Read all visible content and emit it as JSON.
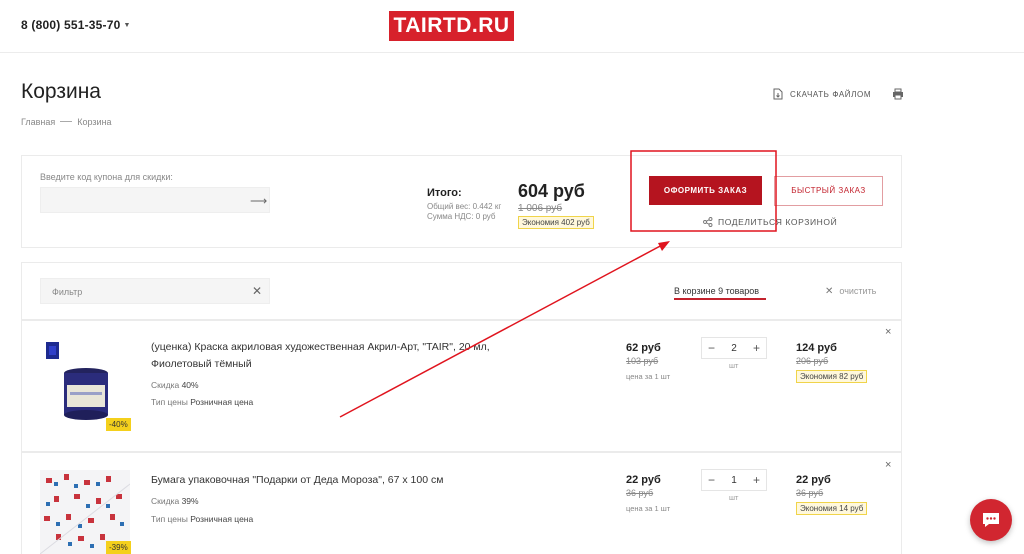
{
  "header": {
    "phone": "8 (800) 551-35-70",
    "logo": "TAIRTD.RU"
  },
  "page": {
    "title": "Корзина",
    "breadcrumbs": [
      "Главная",
      "Корзина"
    ],
    "download_label": "СКАЧАТЬ ФАЙЛОМ"
  },
  "summary": {
    "coupon_label": "Введите код купона для скидки:",
    "total_label": "Итого:",
    "weight": "Общий вес: 0.442 кг",
    "vat": "Сумма НДС: 0 руб",
    "total": "604 руб",
    "old_total": "1 006 руб",
    "savings": "Экономия 402 руб",
    "order_button": "ОФОРМИТЬ ЗАКАЗ",
    "quick_button": "БЫСТРЫЙ ЗАКАЗ",
    "share": "ПОДЕЛИТЬСЯ КОРЗИНОЙ"
  },
  "filter": {
    "placeholder": "Фильтр",
    "in_cart": "В корзине 9 товаров",
    "clear": "очистить"
  },
  "items": [
    {
      "name": "(уценка) Краска акриловая художественная Акрил-Арт, \"TAIR\", 20 мл, Фиолетовый тёмный",
      "discount_label": "Скидка",
      "discount": "40%",
      "price_type_label": "Тип цены",
      "price_type": "Розничная цена",
      "badge": "-40%",
      "price": "62 руб",
      "old_price": "103 руб",
      "per_unit": "цена за 1 шт",
      "qty": "2",
      "unit": "шт",
      "sum": "124 руб",
      "old_sum": "206 руб",
      "savings": "Экономия 82 руб",
      "minus": "−",
      "plus": "+",
      "remove": "×"
    },
    {
      "name": "Бумага упаковочная \"Подарки от Деда Мороза\", 67 х 100 см",
      "discount_label": "Скидка",
      "discount": "39%",
      "price_type_label": "Тип цены",
      "price_type": "Розничная цена",
      "badge": "-39%",
      "price": "22 руб",
      "old_price": "36 руб",
      "per_unit": "цена за 1 шт",
      "qty": "1",
      "unit": "шт",
      "sum": "22 руб",
      "old_sum": "36 руб",
      "savings": "Экономия 14 руб",
      "minus": "−",
      "plus": "+",
      "remove": "×"
    }
  ],
  "icons": {
    "download": "download-file-icon",
    "print": "print-icon",
    "share": "share-icon",
    "coupon_submit": "arrow-right-icon",
    "filter_clear": "close-icon",
    "chat": "chat-icon"
  },
  "colors": {
    "brand_red": "#d7212b",
    "order_button": "#b5141f",
    "highlight": "#e0141e",
    "badge_yellow": "#f4d01c"
  }
}
